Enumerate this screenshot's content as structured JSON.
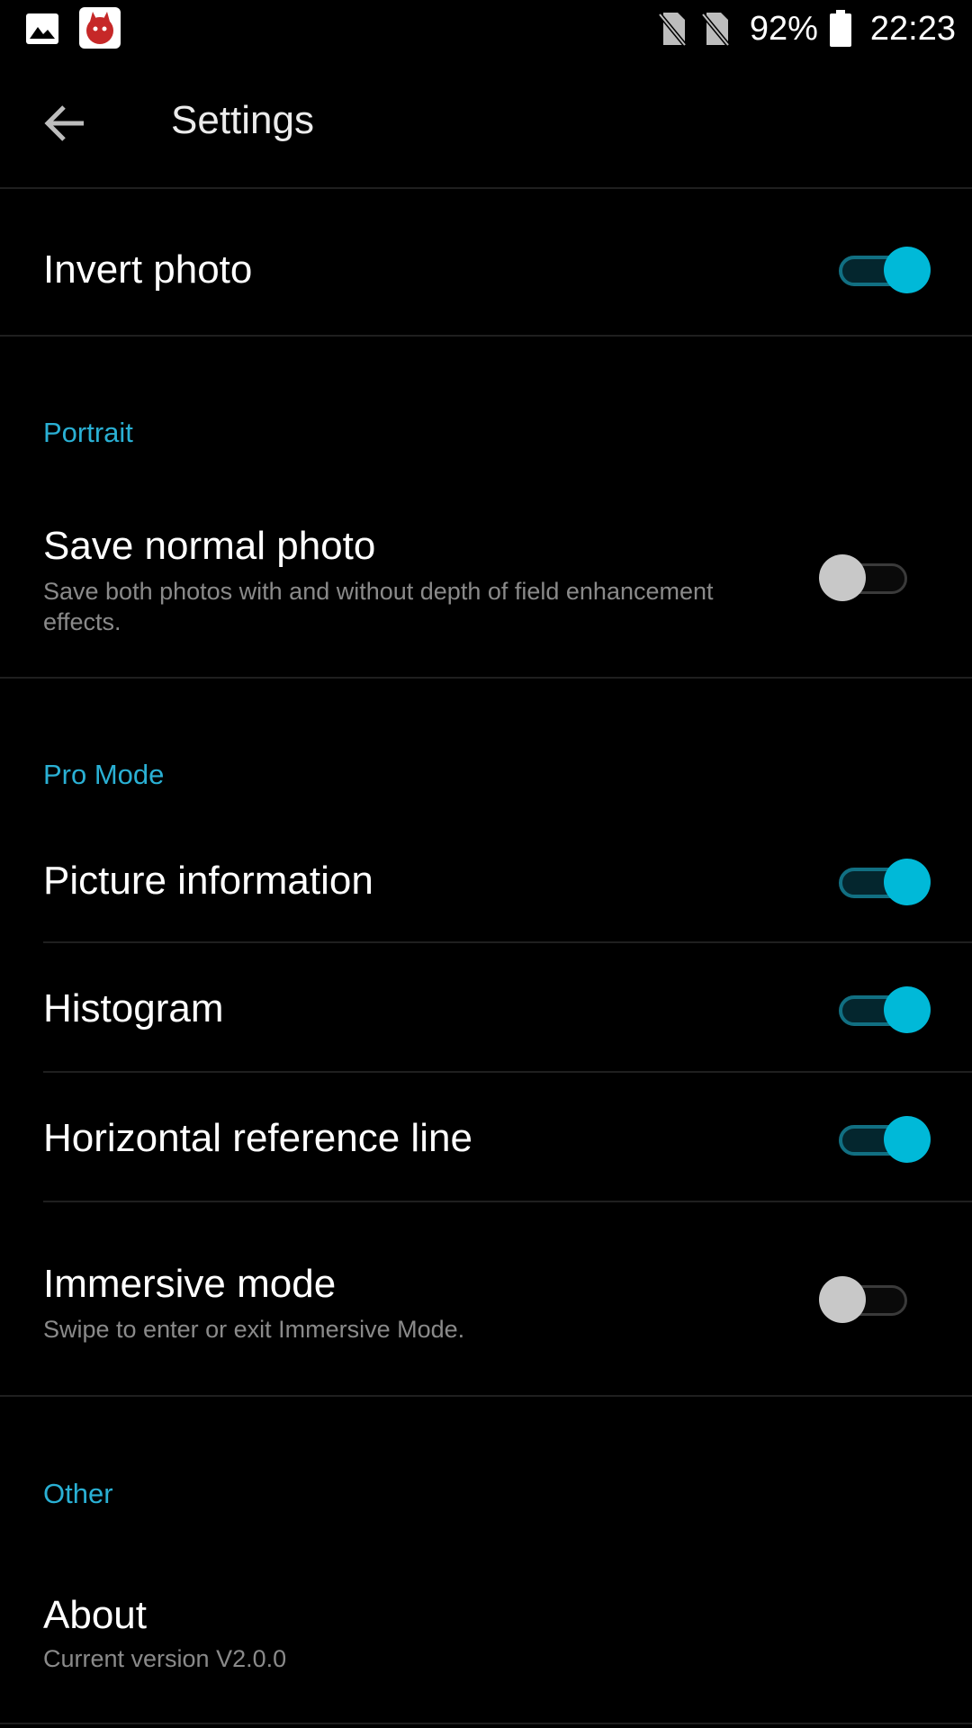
{
  "status_bar": {
    "battery_percent": "92%",
    "time": "22:23",
    "icons": [
      "gallery-icon",
      "antutu-app-icon",
      "no-sim-icon",
      "no-sim-icon",
      "battery-icon"
    ]
  },
  "app_bar": {
    "title": "Settings",
    "back_icon": "arrow-back-icon"
  },
  "colors": {
    "background": "#000000",
    "accent": "#00b9d8",
    "section_header": "#2ab0d4",
    "subtitle": "#8a8a8a"
  },
  "settings": {
    "invert_photo": {
      "title": "Invert photo",
      "enabled": true
    },
    "portrait_header": "Portrait",
    "save_normal_photo": {
      "title": "Save normal photo",
      "subtitle": "Save both photos with and without depth of field enhancement effects.",
      "enabled": false
    },
    "pro_mode_header": "Pro Mode",
    "picture_information": {
      "title": "Picture information",
      "enabled": true
    },
    "histogram": {
      "title": "Histogram",
      "enabled": true
    },
    "horizontal_reference_line": {
      "title": "Horizontal reference line",
      "enabled": true
    },
    "immersive_mode": {
      "title": "Immersive mode",
      "subtitle": "Swipe to enter or exit Immersive Mode.",
      "enabled": false
    },
    "other_header": "Other",
    "about": {
      "title": "About",
      "subtitle": "Current version V2.0.0"
    }
  }
}
